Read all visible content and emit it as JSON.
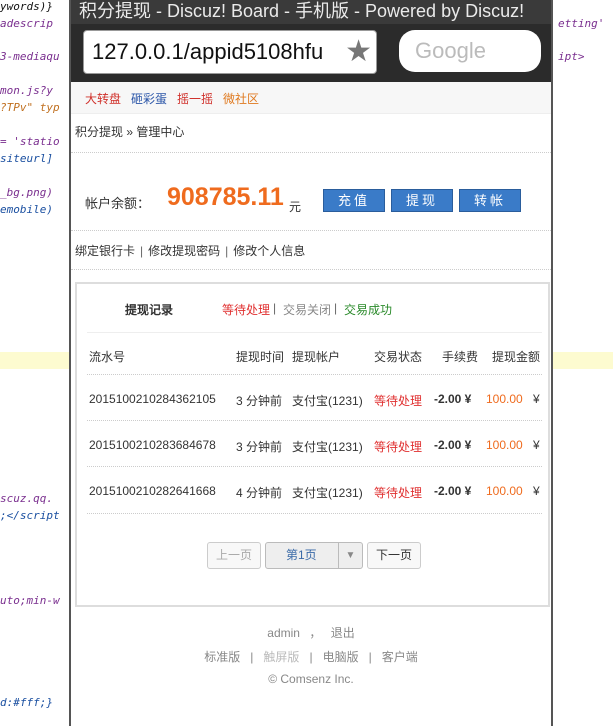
{
  "background_code": [
    {
      "text": "ywords)}",
      "color": "#111"
    },
    {
      "text": "adescrip",
      "color": "#7a2f8f"
    },
    {
      "text": "3-mediaqu",
      "color": "#7a2f8f"
    },
    {
      "text": "mon.js?y",
      "color": "#7a2f8f"
    },
    {
      "text": "?TPv\" typ",
      "color": "#c07020"
    },
    {
      "text": "= 'statio",
      "color": "#7a2f8f"
    },
    {
      "text": "siteurl]",
      "color": "#1a4fa0"
    },
    {
      "text": "_bg.png)",
      "color": "#7a2f8f"
    },
    {
      "text": "emobile)",
      "color": "#1a4fa0"
    },
    {
      "text": "scuz.qq.",
      "color": "#7a2f8f"
    },
    {
      "text": ";</script",
      "color": "#1a4fa0"
    },
    {
      "text": "uto;min-w",
      "color": "#7a2f8f"
    },
    {
      "text": "d:#fff;}",
      "color": "#1a4fa0"
    },
    {
      "text": "etting'",
      "color": "#7a2f8f"
    },
    {
      "text": "ipt>",
      "color": "#7a2f8f"
    }
  ],
  "browser": {
    "title": "积分提现 - Discuz! Board - 手机版 - Powered by Discuz!",
    "url": "127.0.0.1/appid5108hfu",
    "search_placeholder": "Google"
  },
  "topnav": [
    {
      "label": "大转盘",
      "color": "#d0302a"
    },
    {
      "label": "砸彩蛋",
      "color": "#2a55a8"
    },
    {
      "label": "摇一摇",
      "color": "#d0302a"
    },
    {
      "label": "微社区",
      "color": "#e07a20"
    }
  ],
  "breadcrumb": "积分提现 » 管理中心",
  "balance": {
    "label": "帐户余额：",
    "value": "908785.11",
    "unit": "元"
  },
  "actions": {
    "recharge": "充值",
    "withdraw": "提现",
    "transfer": "转帐"
  },
  "links": [
    "绑定银行卡",
    "修改提现密码",
    "修改个人信息"
  ],
  "records": {
    "title": "提现记录",
    "filters": [
      {
        "label": "等待处理",
        "color": "#e03030"
      },
      {
        "label": "交易关闭",
        "color": "#888888"
      },
      {
        "label": "交易成功",
        "color": "#2a8a2a"
      }
    ],
    "headers": [
      "流水号",
      "提现时间",
      "提现帐户",
      "交易状态",
      "手续费",
      "提现金额"
    ],
    "rows": [
      {
        "serial": "2015100210284362105",
        "time": "3 分钟前",
        "account": "支付宝(1231)",
        "status": "等待处理",
        "fee": "-2.00 ¥",
        "amount": "100.00",
        "currency": "¥"
      },
      {
        "serial": "2015100210283684678",
        "time": "3 分钟前",
        "account": "支付宝(1231)",
        "status": "等待处理",
        "fee": "-2.00 ¥",
        "amount": "100.00",
        "currency": "¥"
      },
      {
        "serial": "2015100210282641668",
        "time": "4 分钟前",
        "account": "支付宝(1231)",
        "status": "等待处理",
        "fee": "-2.00 ¥",
        "amount": "100.00",
        "currency": "¥"
      }
    ]
  },
  "pager": {
    "prev": "上一页",
    "current": "第1页",
    "next": "下一页"
  },
  "footer": {
    "user": "admin",
    "user_sep": "，",
    "logout": "退出",
    "modes": [
      "标准版",
      "触屏版",
      "电脑版",
      "客户端"
    ],
    "copyright": "© Comsenz Inc."
  }
}
